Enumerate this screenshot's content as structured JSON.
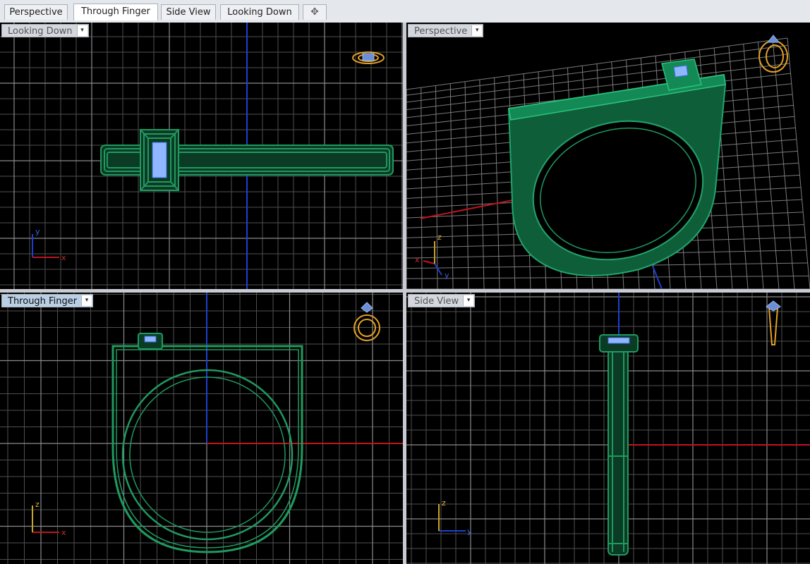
{
  "tabs": [
    {
      "label": "Perspective",
      "active": false
    },
    {
      "label": "Through Finger",
      "active": true
    },
    {
      "label": "Side View",
      "active": false
    },
    {
      "label": "Looking Down",
      "active": false
    }
  ],
  "add_tab_icon": "plus-icon",
  "viewports": {
    "top_left": {
      "title": "Looking Down",
      "axis_labels": [
        "y",
        "x"
      ]
    },
    "top_right": {
      "title": "Perspective",
      "axis_labels": [
        "z",
        "x",
        "y"
      ]
    },
    "bottom_left": {
      "title": "Through Finger",
      "axis_labels": [
        "z",
        "x"
      ]
    },
    "bottom_right": {
      "title": "Side View",
      "axis_labels": [
        "z",
        "y"
      ]
    }
  },
  "colors": {
    "viewport_bg": "#000000",
    "grid": "#5a5a5a",
    "grid_major": "#8a8a8a",
    "model": "#1f9a5f",
    "model_fill": "#0f5e3a",
    "gem": "#8fb6ff",
    "axis_x": "#c0141e",
    "axis_y": "#1d3fd1",
    "axis_z": "#c8a428",
    "gumball": "#e3a126"
  }
}
